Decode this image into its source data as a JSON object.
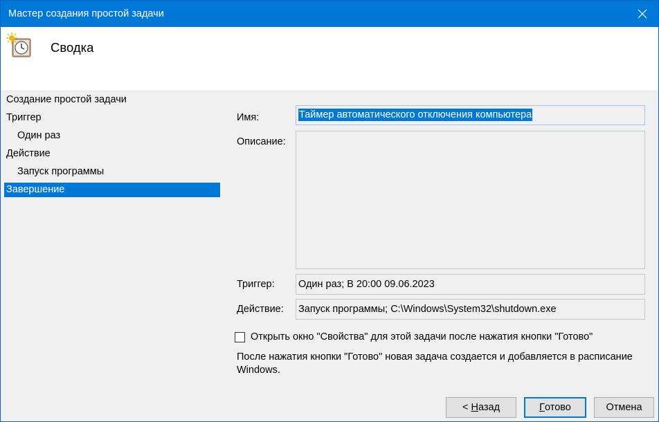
{
  "window": {
    "title": "Мастер создания простой задачи"
  },
  "header": {
    "title": "Сводка",
    "icon": "scheduler-clock-icon"
  },
  "steps": [
    {
      "label": "Создание простой задачи"
    },
    {
      "label": "Триггер"
    },
    {
      "label": "Один раз"
    },
    {
      "label": "Действие"
    },
    {
      "label": "Запуск программы"
    },
    {
      "label": "Завершение"
    }
  ],
  "form": {
    "name_label": "Имя:",
    "name_value": "Таймер автоматического отключения компьютера",
    "description_label": "Описание:",
    "description_value": "",
    "trigger_label": "Триггер:",
    "trigger_value": "Один раз; В 20:00 09.06.2023",
    "action_label": "Действие:",
    "action_value": "Запуск программы; C:\\Windows\\System32\\shutdown.exe"
  },
  "checkbox": {
    "label": "Открыть окно \"Свойства\" для этой задачи после нажатия кнопки \"Готово\"",
    "checked": false
  },
  "note": "После нажатия кнопки \"Готово\" новая задача создается и добавляется в расписание Windows.",
  "buttons": {
    "back": {
      "prefix": "< ",
      "mnemonic": "Н",
      "rest": "азад"
    },
    "done": {
      "mnemonic": "Г",
      "rest": "отово"
    },
    "cancel": "Отмена"
  },
  "colors": {
    "titlebar": "#0078d7",
    "selection": "#0078d7"
  }
}
